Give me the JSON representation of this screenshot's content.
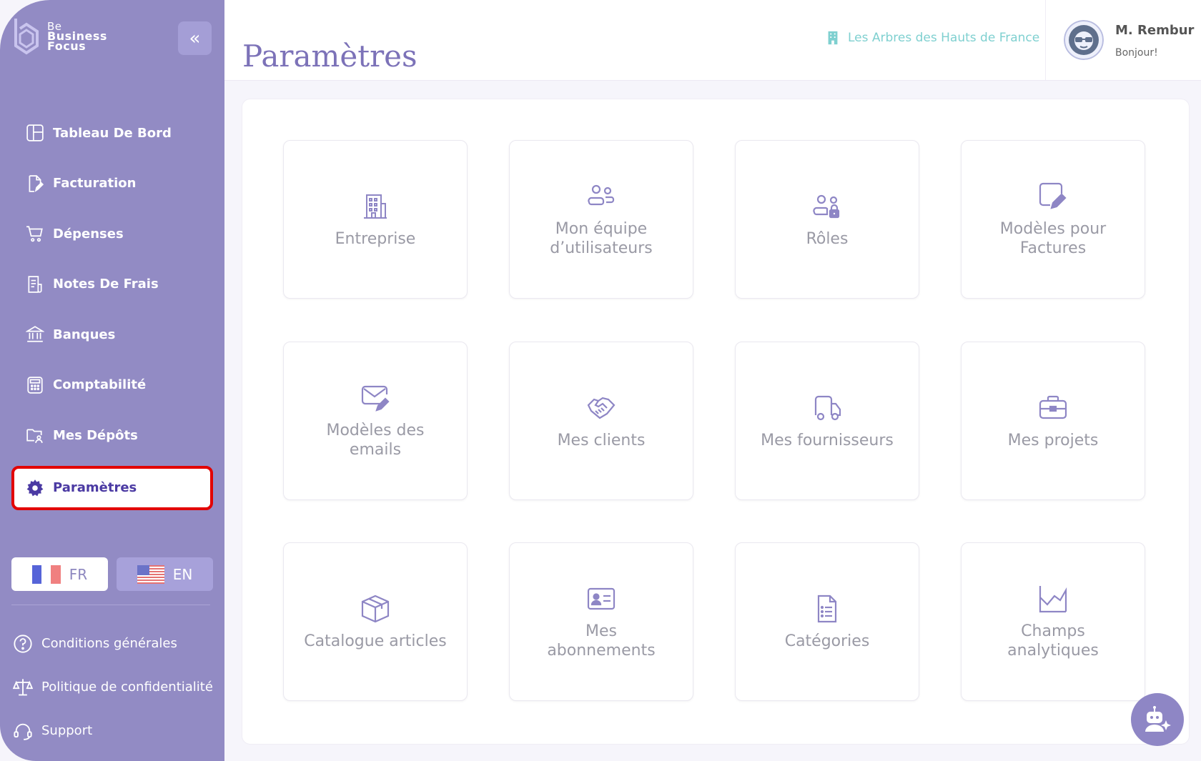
{
  "brand": {
    "line1": "Be",
    "line2": "Business",
    "line3": "Focus"
  },
  "sidebar": {
    "collapse_label": "«",
    "items": [
      {
        "label": "Tableau De Bord",
        "icon": "dashboard-icon"
      },
      {
        "label": "Facturation",
        "icon": "invoice-icon"
      },
      {
        "label": "Dépenses",
        "icon": "cart-icon"
      },
      {
        "label": "Notes De Frais",
        "icon": "receipt-icon"
      },
      {
        "label": "Banques",
        "icon": "bank-icon"
      },
      {
        "label": "Comptabilité",
        "icon": "calculator-icon"
      },
      {
        "label": "Mes Dépôts",
        "icon": "folder-users-icon"
      },
      {
        "label": "Paramètres",
        "icon": "gear-icon",
        "active": true
      }
    ],
    "languages": [
      {
        "code": "FR",
        "active": true
      },
      {
        "code": "EN",
        "active": false
      }
    ],
    "footer": [
      {
        "label": "Conditions générales",
        "icon": "help-circle-icon"
      },
      {
        "label": "Politique de confidentialité",
        "icon": "scales-icon"
      },
      {
        "label": "Support",
        "icon": "headset-icon"
      }
    ]
  },
  "header": {
    "title": "Paramètres",
    "company": "Les Arbres des Hauts de France",
    "user_name": "M. Rembur",
    "greeting": "Bonjour!"
  },
  "tiles": [
    {
      "label": "Entreprise",
      "icon": "building-icon"
    },
    {
      "label": "Mon équipe d’utilisateurs",
      "icon": "users-icon"
    },
    {
      "label": "Rôles",
      "icon": "users-lock-icon"
    },
    {
      "label": "Modèles pour Factures",
      "icon": "document-edit-icon"
    },
    {
      "label": "Modèles des emails",
      "icon": "mail-edit-icon"
    },
    {
      "label": "Mes clients",
      "icon": "handshake-icon"
    },
    {
      "label": "Mes fournisseurs",
      "icon": "truck-icon"
    },
    {
      "label": "Mes projets",
      "icon": "briefcase-icon"
    },
    {
      "label": "Catalogue articles",
      "icon": "box-icon"
    },
    {
      "label": "Mes abonnements",
      "icon": "id-card-icon"
    },
    {
      "label": "Catégories",
      "icon": "list-document-icon"
    },
    {
      "label": "Champs analytiques",
      "icon": "chart-area-icon"
    }
  ],
  "colors": {
    "sidebar": "#928bc4",
    "accent": "#7c72b8",
    "company": "#7fd0d0",
    "active_outline": "#e20000",
    "tile_icon": "#8e86c5"
  }
}
